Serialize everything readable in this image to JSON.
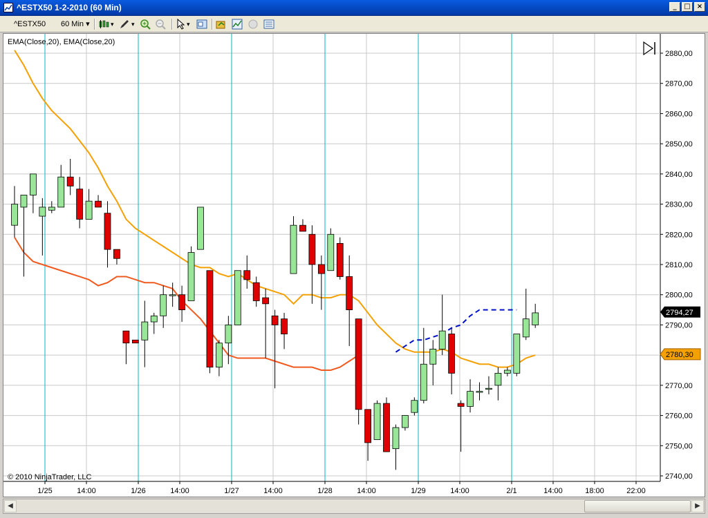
{
  "window": {
    "title": "^ESTX50  1-2-2010 (60 Min)",
    "minimize_glyph": "_",
    "maximize_glyph": "□",
    "close_glyph": "×"
  },
  "toolbar": {
    "instrument": "^ESTX50",
    "interval": "60 Min",
    "icons": [
      "candlestick-icon",
      "pencil-draw-icon",
      "zoom-in-icon",
      "zoom-out-icon",
      "pointer-icon",
      "data-box-icon",
      "folder-strategy-icon",
      "indicators-icon",
      "disabled-circle-icon",
      "properties-icon"
    ]
  },
  "chart": {
    "indicator_label": "EMA(Close,20), EMA(Close,20)",
    "copyright": "© 2010 NinjaTrader, LLC",
    "last_price_label": "2794,27",
    "ema_label": "2780,30",
    "colors": {
      "up": "#99e699",
      "down": "#e00000",
      "ema_slow": "#f4a000",
      "ema_fast": "#f05a1e",
      "forecast": "#0010c8",
      "session_line": "#00b8c0",
      "grid": "#c8c8c8",
      "last_price_bg": "#000000",
      "ema_label_bg": "#f4a000"
    }
  },
  "chart_data": {
    "type": "candlestick",
    "y_ticks": [
      "2880,00",
      "2870,00",
      "2860,00",
      "2850,00",
      "2840,00",
      "2830,00",
      "2820,00",
      "2810,00",
      "2800,00",
      "2790,00",
      "2780,00",
      "2770,00",
      "2760,00",
      "2750,00",
      "2740,00"
    ],
    "ylim": [
      2738,
      2884
    ],
    "x_ticks": [
      "1/25",
      "14:00",
      "1/26",
      "14:00",
      "1/27",
      "14:00",
      "1/28",
      "14:00",
      "1/29",
      "14:00",
      "2/1",
      "14:00",
      "18:00",
      "22:00"
    ],
    "candles": [
      {
        "o": 2823,
        "h": 2836,
        "l": 2819,
        "c": 2830
      },
      {
        "o": 2829,
        "h": 2833,
        "l": 2806,
        "c": 2833
      },
      {
        "o": 2833,
        "h": 2840,
        "l": 2827,
        "c": 2840
      },
      {
        "o": 2826,
        "h": 2832,
        "l": 2813,
        "c": 2829
      },
      {
        "o": 2828,
        "h": 2831,
        "l": 2827,
        "c": 2829
      },
      {
        "o": 2829,
        "h": 2843,
        "l": 2829,
        "c": 2839
      },
      {
        "o": 2839,
        "h": 2845,
        "l": 2833,
        "c": 2836
      },
      {
        "o": 2835,
        "h": 2839,
        "l": 2822,
        "c": 2825
      },
      {
        "o": 2825,
        "h": 2835,
        "l": 2825,
        "c": 2831
      },
      {
        "o": 2831,
        "h": 2833,
        "l": 2829,
        "c": 2829
      },
      {
        "o": 2827,
        "h": 2831,
        "l": 2809,
        "c": 2815
      },
      {
        "o": 2815,
        "h": 2815,
        "l": 2810,
        "c": 2812
      },
      {
        "o": 2788,
        "h": 2788,
        "l": 2777,
        "c": 2784
      },
      {
        "o": 2785,
        "h": 2785,
        "l": 2784,
        "c": 2784
      },
      {
        "o": 2785,
        "h": 2798,
        "l": 2776,
        "c": 2791
      },
      {
        "o": 2791,
        "h": 2794,
        "l": 2787,
        "c": 2793
      },
      {
        "o": 2793,
        "h": 2803,
        "l": 2789,
        "c": 2800
      },
      {
        "o": 2800,
        "h": 2804,
        "l": 2796,
        "c": 2800
      },
      {
        "o": 2800,
        "h": 2803,
        "l": 2791,
        "c": 2795
      },
      {
        "o": 2798,
        "h": 2816,
        "l": 2798,
        "c": 2814
      },
      {
        "o": 2815,
        "h": 2829,
        "l": 2815,
        "c": 2829
      },
      {
        "o": 2808,
        "h": 2808,
        "l": 2774,
        "c": 2776
      },
      {
        "o": 2776,
        "h": 2785,
        "l": 2773,
        "c": 2784
      },
      {
        "o": 2784,
        "h": 2793,
        "l": 2777,
        "c": 2790
      },
      {
        "o": 2790,
        "h": 2808,
        "l": 2790,
        "c": 2808
      },
      {
        "o": 2808,
        "h": 2813,
        "l": 2802,
        "c": 2805
      },
      {
        "o": 2804,
        "h": 2806,
        "l": 2796,
        "c": 2798
      },
      {
        "o": 2799,
        "h": 2802,
        "l": 2779,
        "c": 2797
      },
      {
        "o": 2793,
        "h": 2795,
        "l": 2769,
        "c": 2790
      },
      {
        "o": 2792,
        "h": 2794,
        "l": 2782,
        "c": 2787
      },
      {
        "o": 2807,
        "h": 2826,
        "l": 2807,
        "c": 2823
      },
      {
        "o": 2823,
        "h": 2825,
        "l": 2821,
        "c": 2821
      },
      {
        "o": 2820,
        "h": 2823,
        "l": 2797,
        "c": 2810
      },
      {
        "o": 2810,
        "h": 2813,
        "l": 2795,
        "c": 2807
      },
      {
        "o": 2808,
        "h": 2822,
        "l": 2808,
        "c": 2820
      },
      {
        "o": 2817,
        "h": 2819,
        "l": 2805,
        "c": 2806
      },
      {
        "o": 2806,
        "h": 2813,
        "l": 2783,
        "c": 2795
      },
      {
        "o": 2792,
        "h": 2792,
        "l": 2757,
        "c": 2762
      },
      {
        "o": 2762,
        "h": 2762,
        "l": 2745,
        "c": 2751
      },
      {
        "o": 2752,
        "h": 2765,
        "l": 2752,
        "c": 2764
      },
      {
        "o": 2764,
        "h": 2766,
        "l": 2748,
        "c": 2748
      },
      {
        "o": 2749,
        "h": 2757,
        "l": 2742,
        "c": 2756
      },
      {
        "o": 2756,
        "h": 2760,
        "l": 2755,
        "c": 2760
      },
      {
        "o": 2761,
        "h": 2766,
        "l": 2760,
        "c": 2765
      },
      {
        "o": 2765,
        "h": 2789,
        "l": 2764,
        "c": 2777
      },
      {
        "o": 2777,
        "h": 2785,
        "l": 2770,
        "c": 2782
      },
      {
        "o": 2782,
        "h": 2800,
        "l": 2780,
        "c": 2788
      },
      {
        "o": 2787,
        "h": 2789,
        "l": 2767,
        "c": 2774
      },
      {
        "o": 2764,
        "h": 2765,
        "l": 2748,
        "c": 2763
      },
      {
        "o": 2763,
        "h": 2772,
        "l": 2761,
        "c": 2768
      },
      {
        "o": 2768,
        "h": 2771,
        "l": 2765,
        "c": 2768
      },
      {
        "o": 2769,
        "h": 2773,
        "l": 2767,
        "c": 2769
      },
      {
        "o": 2770,
        "h": 2776,
        "l": 2765,
        "c": 2774
      },
      {
        "o": 2774,
        "h": 2776,
        "l": 2773,
        "c": 2775
      },
      {
        "o": 2774,
        "h": 2787,
        "l": 2773,
        "c": 2787
      },
      {
        "o": 2786,
        "h": 2802,
        "l": 2785,
        "c": 2792
      },
      {
        "o": 2790,
        "h": 2797,
        "l": 2789,
        "c": 2794
      }
    ],
    "ema_slow": [
      2881,
      2876,
      2870,
      2865,
      2861,
      2858,
      2855,
      2851,
      2847,
      2842,
      2836,
      2831,
      2825,
      2822,
      2820,
      2818,
      2816,
      2814,
      2812,
      2810,
      2809,
      2809,
      2807,
      2806,
      2807,
      2805,
      2803,
      2802,
      2801,
      2800,
      2797,
      2800,
      2800,
      2799,
      2799,
      2800,
      2800,
      2798,
      2794,
      2790,
      2787,
      2784,
      2782,
      2781,
      2781,
      2781,
      2782,
      2781,
      2779,
      2778,
      2777,
      2777,
      2776,
      2776,
      2777,
      2779,
      2780
    ],
    "ema_fast": [
      2819,
      2814,
      2811,
      2810,
      2809,
      2808,
      2807,
      2806,
      2805,
      2803,
      2804,
      2806,
      2806,
      2805,
      2804,
      2804,
      2803,
      2802,
      2798,
      2795,
      2792,
      2788,
      2784,
      2780,
      2779,
      2779,
      2779,
      2779,
      2778,
      2777,
      2776,
      2776,
      2776,
      2775,
      2775,
      2776,
      2778,
      2780
    ],
    "forecast": [
      2781,
      2783,
      2785,
      2785,
      2786,
      2787,
      2789,
      2790,
      2793,
      2795,
      2795,
      2795,
      2795,
      2795
    ],
    "session_dividers": [
      "1/25",
      "1/26",
      "1/27",
      "1/28",
      "1/29",
      "2/1"
    ]
  }
}
